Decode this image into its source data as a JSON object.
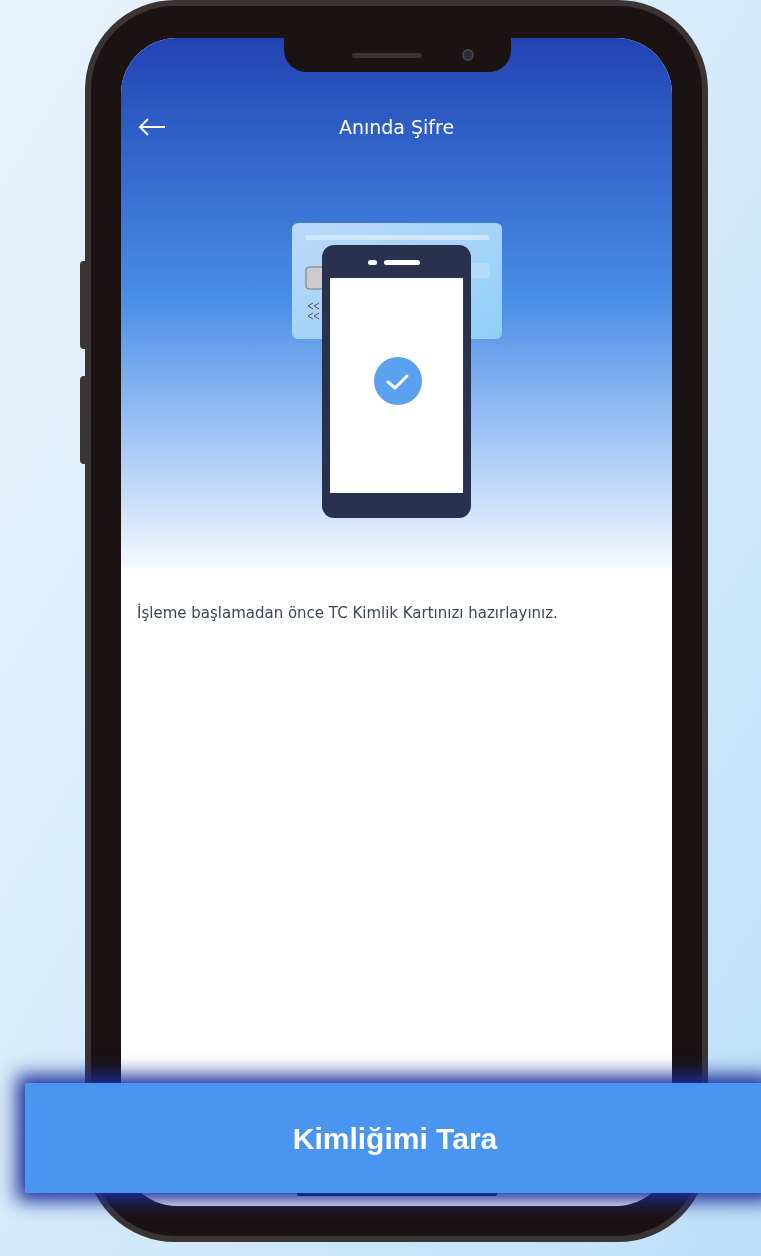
{
  "header": {
    "title": "Anında Şifre"
  },
  "instruction": "İşleme başlamadan önce TC Kimlik Kartınızı hazırlayınız.",
  "primary_button": {
    "label": "Kimliğimi Tara"
  }
}
